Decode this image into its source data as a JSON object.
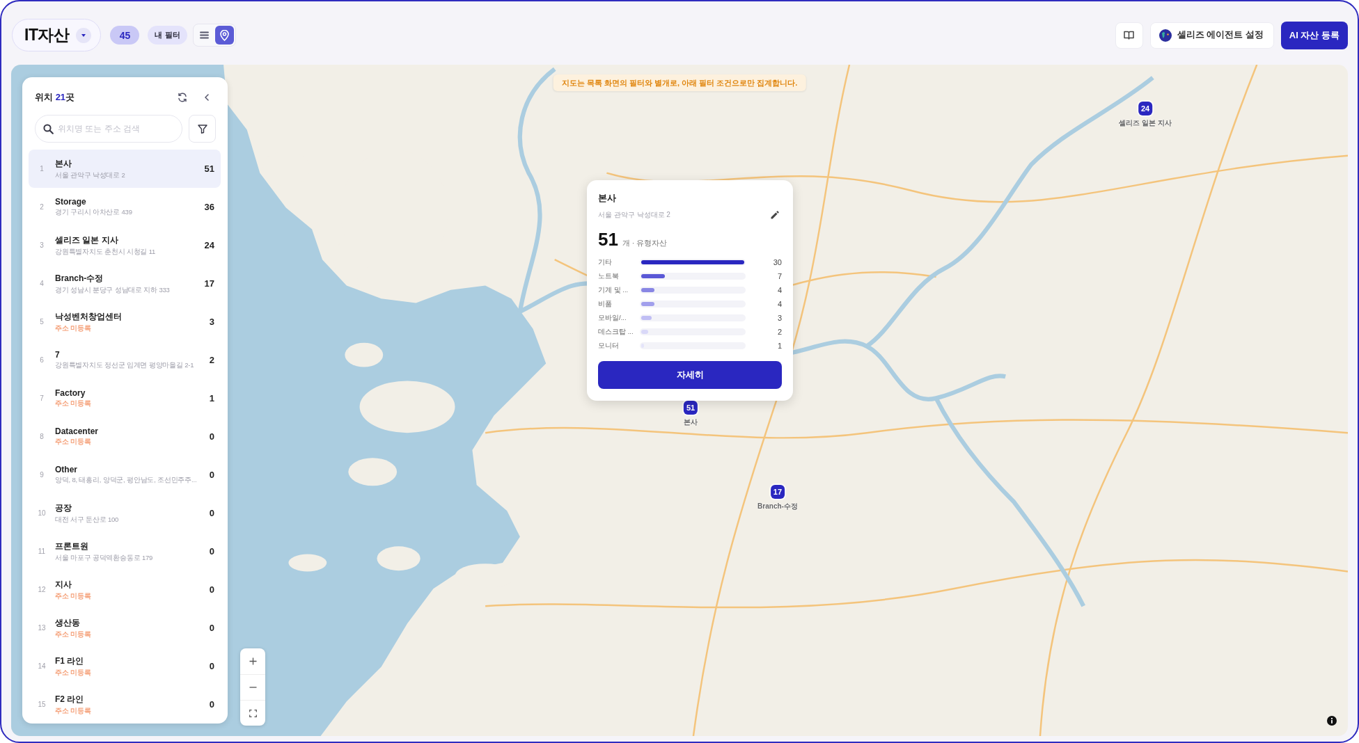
{
  "header": {
    "title": "IT자산",
    "count": "45",
    "filter_label": "내 필터",
    "views": [
      {
        "kind": "list",
        "selected": false
      },
      {
        "kind": "map",
        "selected": true
      }
    ],
    "buttons": [
      {
        "kind": "guide"
      },
      {
        "kind": "agent",
        "label": "셀리즈 에이전트 설정"
      },
      {
        "kind": "primary",
        "label": "AI 자산 등록"
      }
    ]
  },
  "sidebar": {
    "heading": {
      "label": "위치",
      "count": "21",
      "unit": "곳"
    },
    "search": {
      "placeholder": "위치명 또는 주소 검색"
    },
    "locations": [
      {
        "index": "1",
        "name": "본사",
        "address": "서울 관악구 낙성대로 2",
        "count": "51",
        "unregistered": false,
        "selected": true
      },
      {
        "index": "2",
        "name": "Storage",
        "address": "경기 구리시 아차산로 439",
        "count": "36",
        "unregistered": false,
        "selected": false
      },
      {
        "index": "3",
        "name": "셀리즈 일본 지사",
        "address": "강원특별자치도 춘천시 시청길 11",
        "count": "24",
        "unregistered": false,
        "selected": false
      },
      {
        "index": "4",
        "name": "Branch-수정",
        "address": "경기 성남시 분당구 성남대로 지하 333",
        "count": "17",
        "unregistered": false,
        "selected": false
      },
      {
        "index": "5",
        "name": "낙성벤처창업센터",
        "address": "주소 미등록",
        "count": "3",
        "unregistered": true,
        "selected": false
      },
      {
        "index": "6",
        "name": "7",
        "address": "강원특별자치도 정선군 임계면 평양마을길 2-1",
        "count": "2",
        "unregistered": false,
        "selected": false
      },
      {
        "index": "7",
        "name": "Factory",
        "address": "주소 미등록",
        "count": "1",
        "unregistered": true,
        "selected": false
      },
      {
        "index": "8",
        "name": "Datacenter",
        "address": "주소 미등록",
        "count": "0",
        "unregistered": true,
        "selected": false
      },
      {
        "index": "9",
        "name": "Other",
        "address": "양덕, 8, 태흥리, 양덕군, 평안남도, 조선민주주...",
        "count": "0",
        "unregistered": false,
        "selected": false
      },
      {
        "index": "10",
        "name": "공장",
        "address": "대전 서구 둔산로 100",
        "count": "0",
        "unregistered": false,
        "selected": false
      },
      {
        "index": "11",
        "name": "프론트원",
        "address": "서울 마포구 공덕역환승동로 179",
        "count": "0",
        "unregistered": false,
        "selected": false
      },
      {
        "index": "12",
        "name": "지사",
        "address": "주소 미등록",
        "count": "0",
        "unregistered": true,
        "selected": false
      },
      {
        "index": "13",
        "name": "생산동",
        "address": "주소 미등록",
        "count": "0",
        "unregistered": true,
        "selected": false
      },
      {
        "index": "14",
        "name": "F1 라인",
        "address": "주소 미등록",
        "count": "0",
        "unregistered": true,
        "selected": false
      },
      {
        "index": "15",
        "name": "F2 라인",
        "address": "주소 미등록",
        "count": "0",
        "unregistered": true,
        "selected": false
      }
    ]
  },
  "map": {
    "notice": "지도는 목록 화면의 필터와 별개로, 아래 필터 조건으로만 집계합니다.",
    "markers": [
      {
        "count": "51",
        "label": "본사"
      },
      {
        "count": "17",
        "label": "Branch-수정"
      },
      {
        "count": "24",
        "label": "셀리즈 일본 지사"
      }
    ],
    "popup": {
      "title": "본사",
      "address": "서울 관악구 낙성대로 2",
      "total": "51",
      "unit": "개 · 유형자산",
      "breakdown": [
        {
          "label": "기타",
          "value": "30",
          "level": 1,
          "color": "#2a27c0"
        },
        {
          "label": "노트북",
          "value": "7",
          "level": 0.23,
          "color": "#5a58d6"
        },
        {
          "label": "기계 및 ...",
          "value": "4",
          "level": 0.13,
          "color": "#8886e4"
        },
        {
          "label": "비품",
          "value": "4",
          "level": 0.13,
          "color": "#a19fec"
        },
        {
          "label": "모바일/...",
          "value": "3",
          "level": 0.1,
          "color": "#c0bef4"
        },
        {
          "label": "데스크탑 ...",
          "value": "2",
          "level": 0.07,
          "color": "#d9d8f8"
        },
        {
          "label": "모니터",
          "value": "1",
          "level": 0.03,
          "color": "#e4e4fa"
        }
      ],
      "button": "자세히"
    }
  }
}
